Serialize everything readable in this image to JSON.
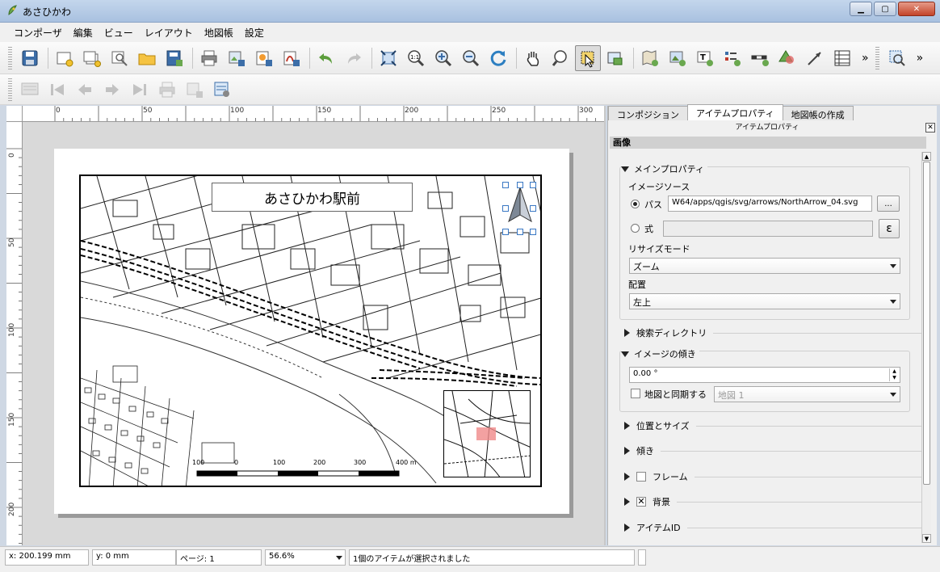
{
  "window": {
    "title": "あさひかわ"
  },
  "menu": [
    "コンポーザ",
    "編集",
    "ビュー",
    "レイアウト",
    "地図帳",
    "設定"
  ],
  "toolbar1": {
    "icons": [
      "save-icon",
      "new-composer-icon",
      "duplicate-composer-icon",
      "composer-manager-icon",
      "open-template-icon",
      "save-template-icon",
      "print-icon",
      "export-image-icon",
      "export-svg-icon",
      "export-pdf-icon",
      "undo-icon",
      "redo-icon",
      "zoom-full-icon",
      "zoom-actual-icon",
      "zoom-in-icon",
      "zoom-out-icon",
      "refresh-icon",
      "pan-icon",
      "zoom-tool-icon",
      "select-move-icon",
      "move-content-icon",
      "add-map-icon",
      "add-image-icon",
      "add-label-icon",
      "add-legend-icon",
      "add-scalebar-icon",
      "add-shape-icon",
      "add-arrow-icon",
      "add-table-icon",
      "select-features-icon"
    ],
    "more": "»"
  },
  "toolbar2": {
    "icons": [
      "atlas-preview-icon",
      "first-feature-icon",
      "previous-feature-icon",
      "next-feature-icon",
      "last-feature-icon",
      "print-atlas-icon",
      "export-atlas-icon",
      "atlas-settings-icon"
    ]
  },
  "ruler": {
    "top_labels": [
      "0",
      "50",
      "100",
      "150",
      "200",
      "250",
      "300"
    ],
    "left_labels": [
      "0",
      "50",
      "100",
      "150",
      "200"
    ]
  },
  "map": {
    "title": "あさひかわ駅前",
    "scalebar_labels": [
      "100",
      "0",
      "100",
      "200",
      "300",
      "400 m"
    ]
  },
  "dock": {
    "tabs": [
      "コンポジション",
      "アイテムプロパティ",
      "地図帳の作成"
    ],
    "subtitle": "アイテムプロパティ",
    "section": "画像",
    "main_props": {
      "title": "メインプロパティ",
      "image_source": "イメージソース",
      "path_label": "パス",
      "path_value": "W64/apps/qgis/svg/arrows/NorthArrow_04.svg",
      "browse_label": "...",
      "expr_label": "式",
      "expr_value": "",
      "expr_button": "ε",
      "resize_mode_label": "リサイズモード",
      "resize_mode_value": "ズーム",
      "placement_label": "配置",
      "placement_value": "左上"
    },
    "search_dirs": "検索ディレクトリ",
    "rotation": {
      "title": "イメージの傾き",
      "value": "0.00 °",
      "sync_label": "地図と同期する",
      "sync_map": "地図 1"
    },
    "collapsed": {
      "position_size": "位置とサイズ",
      "rotation": "傾き",
      "frame": "フレーム",
      "background": "背景",
      "item_id": "アイテムID"
    }
  },
  "status": {
    "x": "x: 200.199 mm",
    "y": "y: 0 mm",
    "page": "ページ: 1",
    "zoom": "56.6%",
    "message": "1個のアイテムが選択されました"
  }
}
